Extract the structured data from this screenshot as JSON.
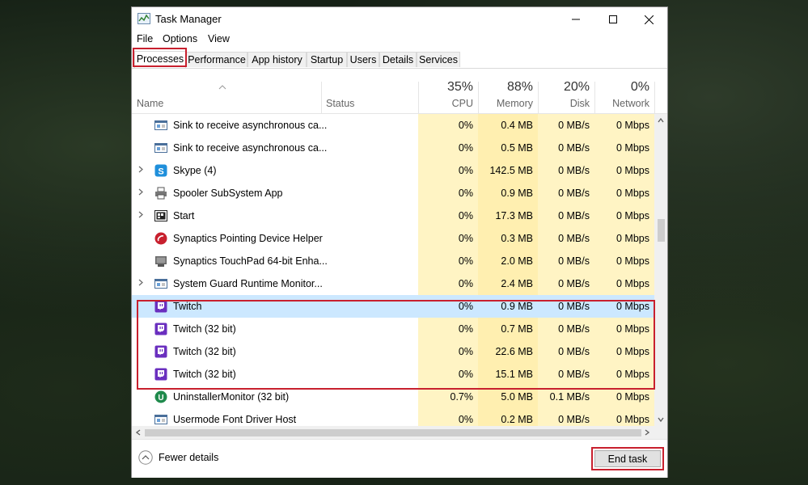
{
  "window": {
    "title": "Task Manager"
  },
  "menu": [
    "File",
    "Options",
    "View"
  ],
  "tabs": [
    "Processes",
    "Performance",
    "App history",
    "Startup",
    "Users",
    "Details",
    "Services"
  ],
  "columns": {
    "name": "Name",
    "status": "Status",
    "cpu": {
      "pct": "35%",
      "label": "CPU"
    },
    "memory": {
      "pct": "88%",
      "label": "Memory"
    },
    "disk": {
      "pct": "20%",
      "label": "Disk"
    },
    "network": {
      "pct": "0%",
      "label": "Network"
    }
  },
  "rows": [
    {
      "name": "Sink to receive asynchronous ca...",
      "cpu": "0%",
      "memory": "0.4 MB",
      "disk": "0 MB/s",
      "network": "0 Mbps",
      "icon": "window-icon",
      "expandable": false,
      "selected": false
    },
    {
      "name": "Sink to receive asynchronous ca...",
      "cpu": "0%",
      "memory": "0.5 MB",
      "disk": "0 MB/s",
      "network": "0 Mbps",
      "icon": "window-icon",
      "expandable": false,
      "selected": false
    },
    {
      "name": "Skype (4)",
      "cpu": "0%",
      "memory": "142.5 MB",
      "disk": "0 MB/s",
      "network": "0 Mbps",
      "icon": "skype-icon",
      "expandable": true,
      "selected": false
    },
    {
      "name": "Spooler SubSystem App",
      "cpu": "0%",
      "memory": "0.9 MB",
      "disk": "0 MB/s",
      "network": "0 Mbps",
      "icon": "printer-icon",
      "expandable": true,
      "selected": false
    },
    {
      "name": "Start",
      "cpu": "0%",
      "memory": "17.3 MB",
      "disk": "0 MB/s",
      "network": "0 Mbps",
      "icon": "start-icon",
      "expandable": true,
      "selected": false
    },
    {
      "name": "Synaptics Pointing Device Helper",
      "cpu": "0%",
      "memory": "0.3 MB",
      "disk": "0 MB/s",
      "network": "0 Mbps",
      "icon": "synaptics-icon",
      "expandable": false,
      "selected": false
    },
    {
      "name": "Synaptics TouchPad 64-bit Enha...",
      "cpu": "0%",
      "memory": "2.0 MB",
      "disk": "0 MB/s",
      "network": "0 Mbps",
      "icon": "touchpad-icon",
      "expandable": false,
      "selected": false
    },
    {
      "name": "System Guard Runtime Monitor...",
      "cpu": "0%",
      "memory": "2.4 MB",
      "disk": "0 MB/s",
      "network": "0 Mbps",
      "icon": "window-icon",
      "expandable": true,
      "selected": false
    },
    {
      "name": "Twitch",
      "cpu": "0%",
      "memory": "0.9 MB",
      "disk": "0 MB/s",
      "network": "0 Mbps",
      "icon": "twitch-icon",
      "expandable": false,
      "selected": true
    },
    {
      "name": "Twitch (32 bit)",
      "cpu": "0%",
      "memory": "0.7 MB",
      "disk": "0 MB/s",
      "network": "0 Mbps",
      "icon": "twitch-icon",
      "expandable": false,
      "selected": false
    },
    {
      "name": "Twitch (32 bit)",
      "cpu": "0%",
      "memory": "22.6 MB",
      "disk": "0 MB/s",
      "network": "0 Mbps",
      "icon": "twitch-icon",
      "expandable": false,
      "selected": false
    },
    {
      "name": "Twitch (32 bit)",
      "cpu": "0%",
      "memory": "15.1 MB",
      "disk": "0 MB/s",
      "network": "0 Mbps",
      "icon": "twitch-icon",
      "expandable": false,
      "selected": false
    },
    {
      "name": "UninstallerMonitor (32 bit)",
      "cpu": "0.7%",
      "memory": "5.0 MB",
      "disk": "0.1 MB/s",
      "network": "0 Mbps",
      "icon": "uninstaller-icon",
      "expandable": false,
      "selected": false
    },
    {
      "name": "Usermode Font Driver Host",
      "cpu": "0%",
      "memory": "0.2 MB",
      "disk": "0 MB/s",
      "network": "0 Mbps",
      "icon": "window-icon",
      "expandable": false,
      "selected": false
    }
  ],
  "footer": {
    "fewer_details": "Fewer details",
    "end_task": "End task"
  },
  "colors": {
    "heat_light": "#fff4c4",
    "heat_mid": "#ffefb0",
    "selection": "#cce8ff",
    "highlight": "#c8202e"
  }
}
